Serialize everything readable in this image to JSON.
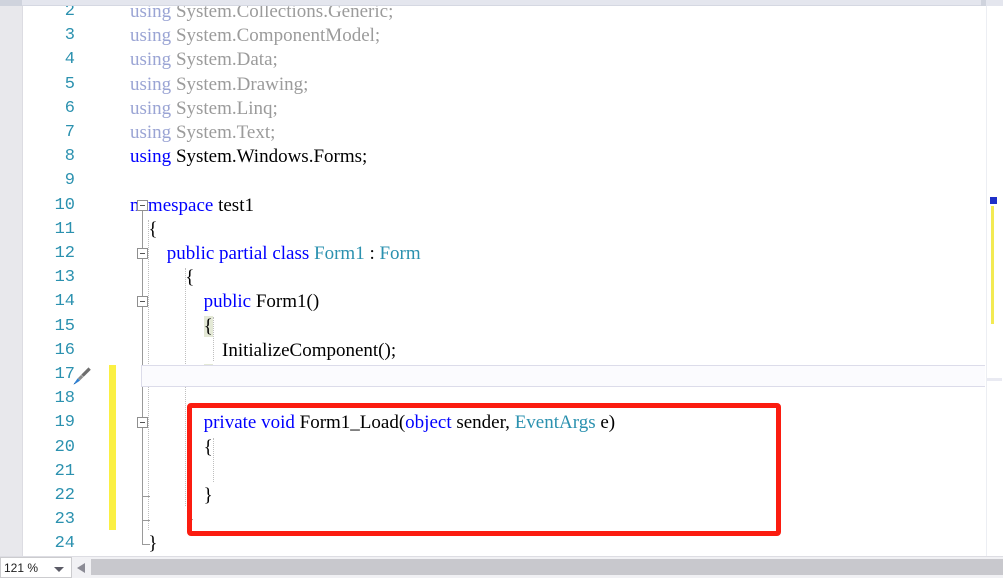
{
  "app": {
    "kind": "code-editor",
    "language": "csharp"
  },
  "colors": {
    "keyword": "#0000ff",
    "type": "#2b91af",
    "plain": "#000000",
    "dimmed": "#9b9b9b",
    "line_number": "#2b91af",
    "change_bar": "#fbf043",
    "annotation": "#fb1c10",
    "brace_match_bg": "#e4e9d6",
    "current_line_border": "#dcdcea"
  },
  "editor": {
    "first_visible_line": 2,
    "last_visible_line": 24,
    "current_line": 17,
    "lines": [
      {
        "n": 2,
        "indent": 0,
        "dimmed": true,
        "tokens": [
          {
            "t": "using",
            "c": "kw-dim"
          },
          {
            "t": " System.Collections.Generic;",
            "c": "dim"
          }
        ]
      },
      {
        "n": 3,
        "indent": 0,
        "dimmed": true,
        "tokens": [
          {
            "t": "using",
            "c": "kw-dim"
          },
          {
            "t": " System.ComponentModel;",
            "c": "dim"
          }
        ]
      },
      {
        "n": 4,
        "indent": 0,
        "dimmed": true,
        "tokens": [
          {
            "t": "using",
            "c": "kw-dim"
          },
          {
            "t": " System.Data;",
            "c": "dim"
          }
        ]
      },
      {
        "n": 5,
        "indent": 0,
        "dimmed": true,
        "tokens": [
          {
            "t": "using",
            "c": "kw-dim"
          },
          {
            "t": " System.Drawing;",
            "c": "dim"
          }
        ]
      },
      {
        "n": 6,
        "indent": 0,
        "dimmed": true,
        "tokens": [
          {
            "t": "using",
            "c": "kw-dim"
          },
          {
            "t": " System.Linq;",
            "c": "dim"
          }
        ]
      },
      {
        "n": 7,
        "indent": 0,
        "dimmed": true,
        "tokens": [
          {
            "t": "using",
            "c": "kw-dim"
          },
          {
            "t": " System.Text;",
            "c": "dim"
          }
        ]
      },
      {
        "n": 8,
        "indent": 0,
        "dimmed": false,
        "tokens": [
          {
            "t": "using",
            "c": "kw"
          },
          {
            "t": " System.Windows.Forms;",
            "c": ""
          }
        ]
      },
      {
        "n": 9,
        "indent": 0,
        "tokens": []
      },
      {
        "n": 10,
        "indent": 0,
        "tokens": [
          {
            "t": "namespace",
            "c": "kw"
          },
          {
            "t": " test1",
            "c": ""
          }
        ]
      },
      {
        "n": 11,
        "indent": 1,
        "tokens": [
          {
            "t": "{",
            "c": ""
          }
        ]
      },
      {
        "n": 12,
        "indent": 2,
        "tokens": [
          {
            "t": "public partial class",
            "c": "kw"
          },
          {
            "t": " ",
            "c": ""
          },
          {
            "t": "Form1",
            "c": "type"
          },
          {
            "t": " : ",
            "c": ""
          },
          {
            "t": "Form",
            "c": "type"
          }
        ]
      },
      {
        "n": 13,
        "indent": 3,
        "tokens": [
          {
            "t": "{",
            "c": ""
          }
        ]
      },
      {
        "n": 14,
        "indent": 4,
        "tokens": [
          {
            "t": "public",
            "c": "kw"
          },
          {
            "t": " Form1()",
            "c": ""
          }
        ]
      },
      {
        "n": 15,
        "indent": 4,
        "tokens": [
          {
            "t": "{",
            "c": "brace-hl"
          }
        ]
      },
      {
        "n": 16,
        "indent": 5,
        "tokens": [
          {
            "t": "InitializeComponent();",
            "c": ""
          }
        ]
      },
      {
        "n": 17,
        "indent": 4,
        "tokens": [
          {
            "t": "}",
            "c": "brace-hl"
          }
        ]
      },
      {
        "n": 18,
        "indent": 0,
        "tokens": []
      },
      {
        "n": 19,
        "indent": 4,
        "tokens": [
          {
            "t": "private void",
            "c": "kw"
          },
          {
            "t": " Form1_Load(",
            "c": ""
          },
          {
            "t": "object",
            "c": "kw"
          },
          {
            "t": " sender, ",
            "c": ""
          },
          {
            "t": "EventArgs",
            "c": "type"
          },
          {
            "t": " e)",
            "c": ""
          }
        ]
      },
      {
        "n": 20,
        "indent": 4,
        "tokens": [
          {
            "t": "{",
            "c": ""
          }
        ]
      },
      {
        "n": 21,
        "indent": 0,
        "tokens": []
      },
      {
        "n": 22,
        "indent": 4,
        "tokens": [
          {
            "t": "}",
            "c": ""
          }
        ]
      },
      {
        "n": 23,
        "indent": 3,
        "tokens": [
          {
            "t": "}",
            "c": ""
          }
        ]
      },
      {
        "n": 24,
        "indent": 1,
        "tokens": [
          {
            "t": "}",
            "c": ""
          }
        ]
      }
    ],
    "change_bar_lines": [
      17,
      18,
      19,
      20,
      21,
      22,
      23
    ],
    "outlining": [
      {
        "line": 10,
        "state": "expanded"
      },
      {
        "line": 12,
        "state": "expanded"
      },
      {
        "line": 14,
        "state": "expanded"
      },
      {
        "line": 19,
        "state": "expanded"
      }
    ],
    "quick_actions_icon": {
      "line": 17,
      "icon": "paintbrush-icon"
    }
  },
  "annotation": {
    "shape": "rectangle",
    "color": "#fb1c10",
    "covers_lines": [
      19,
      20,
      21,
      22
    ]
  },
  "statusbar": {
    "zoom_value": "121 %",
    "zoom_dropdown_icon": "chevron-down-icon",
    "hscroll_left_icon": "scroll-left-arrow-icon"
  },
  "right_margin": {
    "caret_icon": "scroll-down-arrow-icon",
    "markers": [
      {
        "type": "bookmark",
        "color": "#1f30c8"
      },
      {
        "type": "change",
        "color": "#f3ea52"
      }
    ]
  }
}
